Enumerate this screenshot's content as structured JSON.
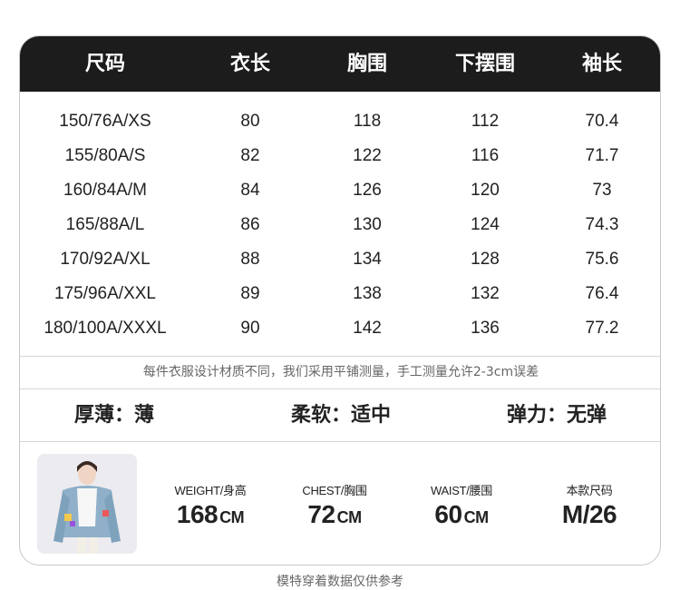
{
  "table": {
    "headers": [
      "尺码",
      "衣长",
      "胸围",
      "下摆围",
      "袖长"
    ],
    "rows": [
      [
        "150/76A/XS",
        "80",
        "118",
        "112",
        "70.4"
      ],
      [
        "155/80A/S",
        "82",
        "122",
        "116",
        "71.7"
      ],
      [
        "160/84A/M",
        "84",
        "126",
        "120",
        "73"
      ],
      [
        "165/88A/L",
        "86",
        "130",
        "124",
        "74.3"
      ],
      [
        "170/92A/XL",
        "88",
        "134",
        "128",
        "75.6"
      ],
      [
        "175/96A/XXL",
        "89",
        "138",
        "132",
        "76.4"
      ],
      [
        "180/100A/XXXL",
        "90",
        "142",
        "136",
        "77.2"
      ]
    ]
  },
  "note": "每件衣服设计材质不同，我们采用平铺测量，手工测量允许2-3cm误差",
  "properties": [
    "厚薄：薄",
    "柔软：适中",
    "弹力：无弹"
  ],
  "model": {
    "height": {
      "label": "WEIGHT/身高",
      "value": "168",
      "unit": "CM"
    },
    "chest": {
      "label": "CHEST/胸围",
      "value": "72",
      "unit": "CM"
    },
    "waist": {
      "label": "WAIST/腰围",
      "value": "60",
      "unit": "CM"
    },
    "size": {
      "label": "本款尺码",
      "value": "M/26"
    }
  },
  "footer": "模特穿着数据仅供参考"
}
